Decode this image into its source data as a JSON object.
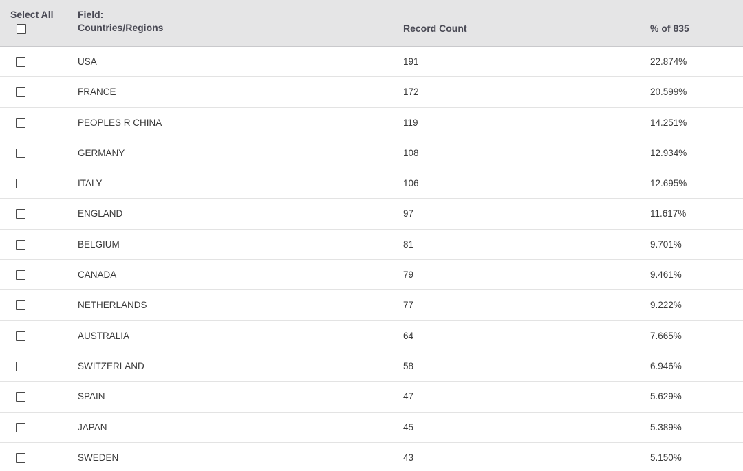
{
  "header": {
    "select_all": "Select All",
    "field_label": "Field:",
    "field_name": "Countries/Regions",
    "record_count": "Record Count",
    "percent_of": "% of 835"
  },
  "rows": [
    {
      "country": "USA",
      "count": "191",
      "pct": "22.874%"
    },
    {
      "country": "FRANCE",
      "count": "172",
      "pct": "20.599%"
    },
    {
      "country": "PEOPLES R CHINA",
      "count": "119",
      "pct": "14.251%"
    },
    {
      "country": "GERMANY",
      "count": "108",
      "pct": "12.934%"
    },
    {
      "country": "ITALY",
      "count": "106",
      "pct": "12.695%"
    },
    {
      "country": "ENGLAND",
      "count": "97",
      "pct": "11.617%"
    },
    {
      "country": "BELGIUM",
      "count": "81",
      "pct": "9.701%"
    },
    {
      "country": "CANADA",
      "count": "79",
      "pct": "9.461%"
    },
    {
      "country": "NETHERLANDS",
      "count": "77",
      "pct": "9.222%"
    },
    {
      "country": "AUSTRALIA",
      "count": "64",
      "pct": "7.665%"
    },
    {
      "country": "SWITZERLAND",
      "count": "58",
      "pct": "6.946%"
    },
    {
      "country": "SPAIN",
      "count": "47",
      "pct": "5.629%"
    },
    {
      "country": "JAPAN",
      "count": "45",
      "pct": "5.389%"
    },
    {
      "country": "SWEDEN",
      "count": "43",
      "pct": "5.150%"
    }
  ]
}
